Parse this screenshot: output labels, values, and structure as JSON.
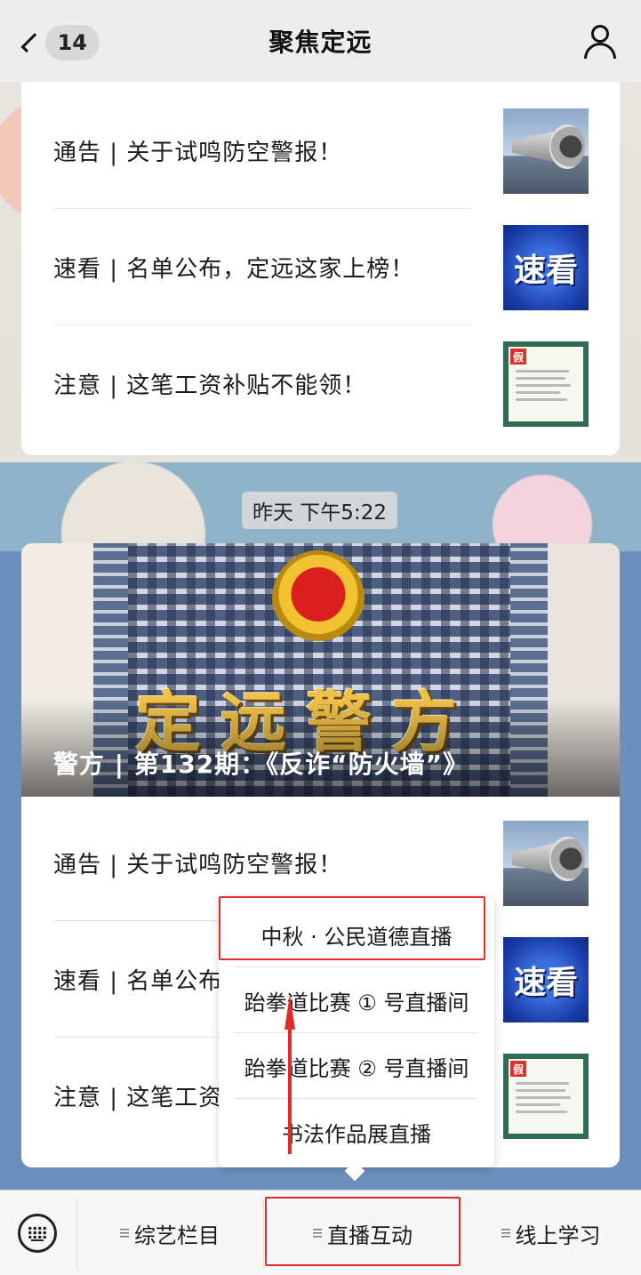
{
  "header": {
    "back_count": "14",
    "title": "聚焦定远"
  },
  "card1": {
    "items": [
      {
        "title": "通告 | 关于试鸣防空警报！",
        "thumb": "siren-image"
      },
      {
        "title": "速看 | 名单公布，定远这家上榜！",
        "thumb": "speed-image",
        "thumb_text": "速看"
      },
      {
        "title": "注意 | 这笔工资补贴不能领！",
        "thumb": "document-image",
        "thumb_stamp": "假"
      }
    ]
  },
  "timestamp": "昨天 下午5:22",
  "card2": {
    "hero_title": "警方 | 第132期：《反诈“防火墙”》",
    "hero_logo_text": "定远警方",
    "items": [
      {
        "title": "通告 | 关于试鸣防空警报！",
        "thumb": "siren-image"
      },
      {
        "title": "速看 | 名单公布",
        "thumb": "speed-image",
        "thumb_text": "速看"
      },
      {
        "title": "注意 | 这笔工资",
        "thumb": "document-image",
        "thumb_stamp": "假"
      }
    ]
  },
  "popup_menu": {
    "items": [
      "中秋 · 公民道德直播",
      "跆拳道比赛 ① 号直播间",
      "跆拳道比赛 ② 号直播间",
      "书法作品展直播"
    ]
  },
  "bottom_menu": {
    "items": [
      "综艺栏目",
      "直播互动",
      "线上学习"
    ]
  },
  "colors": {
    "highlight": "#e02b2b",
    "background": "#ededed"
  }
}
